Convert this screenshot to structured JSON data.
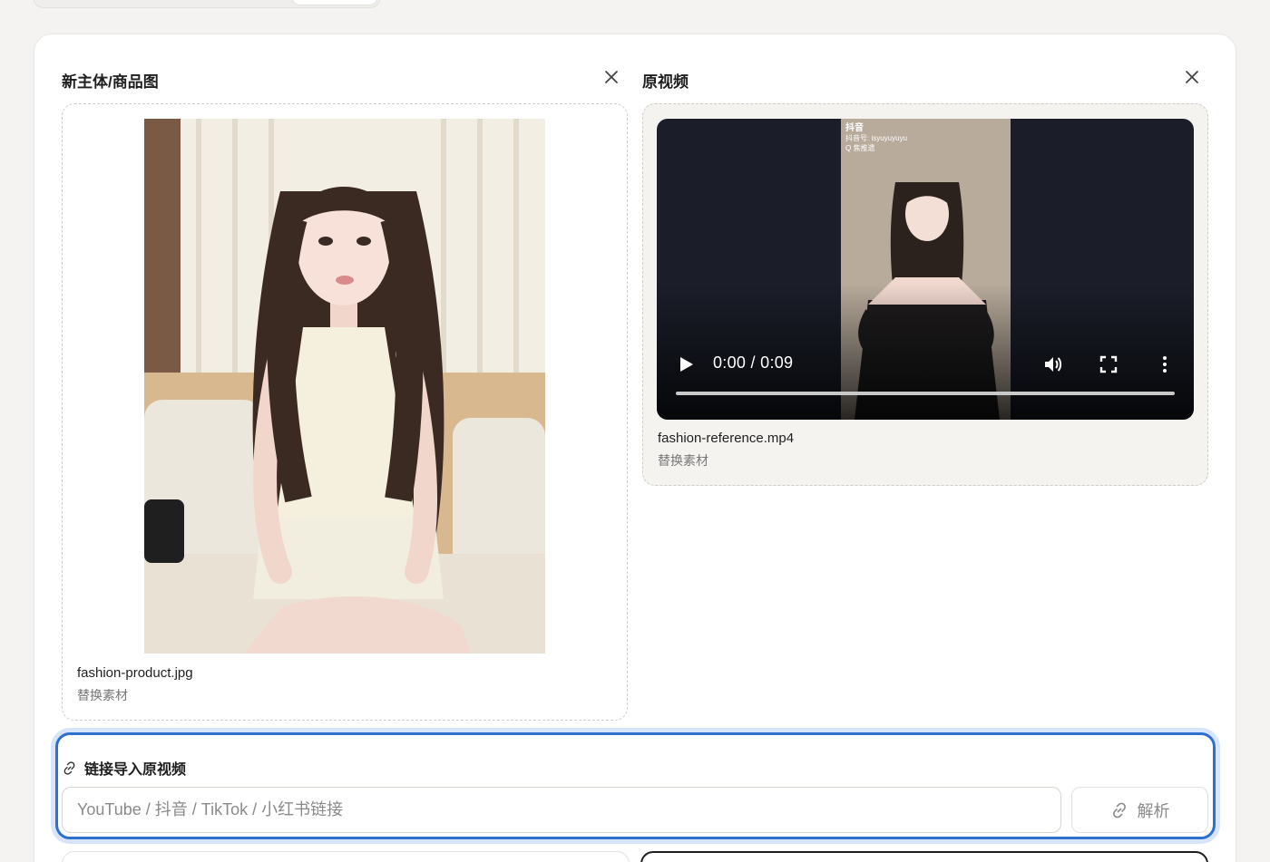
{
  "left_panel": {
    "title": "新主体/商品图",
    "file_name": "fashion-product.jpg",
    "replace_label": "替换素材",
    "close_icon": "close-icon"
  },
  "right_panel": {
    "title": "原视频",
    "file_name": "fashion-reference.mp4",
    "replace_label": "替换素材",
    "close_icon": "close-icon",
    "video": {
      "time": "0:00 / 0:09",
      "progress": 0,
      "overlay_brand": "抖音",
      "overlay_line1": "抖音号: isyuyuyuyu",
      "overlay_line2": "Q 焦推遗"
    }
  },
  "link_import": {
    "title": "链接导入原视频",
    "placeholder": "YouTube / 抖音 / TikTok / 小红书链接",
    "value": "",
    "parse_label": "解析"
  },
  "colors": {
    "accent": "#2f6fcf",
    "focus_ring": "#d6e5fb",
    "card_bg": "#ffffff",
    "page_bg": "#f4f3f1"
  }
}
